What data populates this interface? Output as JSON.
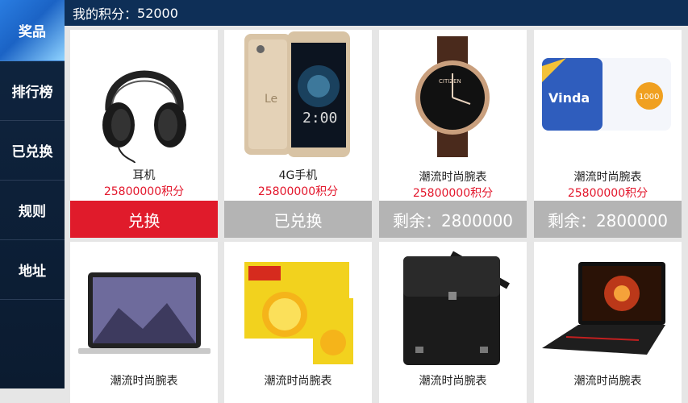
{
  "sidebar": {
    "items": [
      {
        "label": "奖品"
      },
      {
        "label": "排行榜"
      },
      {
        "label": "已兑换"
      },
      {
        "label": "规则"
      },
      {
        "label": "地址"
      }
    ]
  },
  "header": {
    "label": "我的积分：",
    "value": "52000"
  },
  "products": [
    {
      "name": "耳机",
      "points": "25800000积分",
      "action": "兑换"
    },
    {
      "name": "4G手机",
      "points": "25800000积分",
      "action": "已兑换"
    },
    {
      "name": "潮流时尚腕表",
      "points": "25800000积分",
      "action": "剩余：2800000"
    },
    {
      "name": "潮流时尚腕表",
      "points": "25800000积分",
      "action": "剩余：2800000"
    },
    {
      "name": "潮流时尚腕表"
    },
    {
      "name": "潮流时尚腕表"
    },
    {
      "name": "潮流时尚腕表"
    },
    {
      "name": "潮流时尚腕表"
    }
  ],
  "icons": {
    "p1": "headphones-icon",
    "p2": "smartphone-icon",
    "p3": "wristwatch-icon",
    "p4": "tissue-pack-icon",
    "p5": "laptop-icon",
    "p6": "juice-box-icon",
    "p7": "shoulder-bag-icon",
    "p8": "gaming-laptop-icon"
  },
  "colors": {
    "accent_red": "#e01b2b",
    "points_red": "#e3162b",
    "header_bg": "#0e2f57",
    "sidebar_bg": "#0f2540"
  }
}
